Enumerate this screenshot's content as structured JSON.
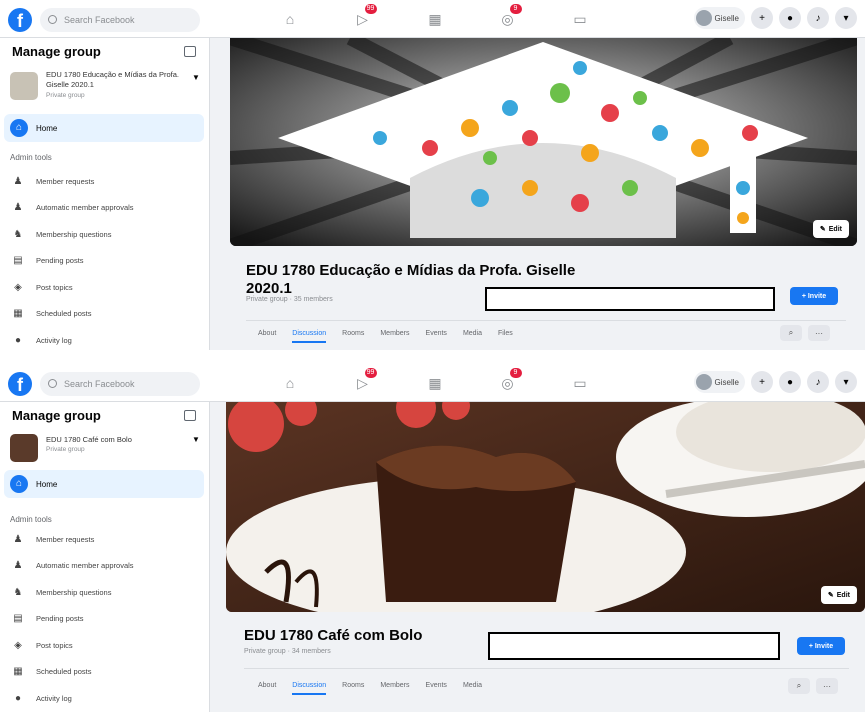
{
  "colors": {
    "brand": "#1877f2",
    "badge": "#e41e3f",
    "highlight_box": "#000000"
  },
  "screens": [
    {
      "search_placeholder": "Search Facebook",
      "nav_badges": [
        "99",
        "9"
      ],
      "profile_name": "Giselle",
      "sidebar": {
        "title": "Manage group",
        "group_name": "EDU 1780 Educação e Mídias da Profa. Giselle 2020.1",
        "group_privacy": "Private group",
        "home_label": "Home",
        "admin_tools_label": "Admin tools",
        "admin_items": [
          "Member requests",
          "Automatic member approvals",
          "Membership questions",
          "Pending posts",
          "Post topics",
          "Scheduled posts",
          "Activity log"
        ]
      },
      "main": {
        "edit_label": "Edit",
        "title": "EDU 1780 Educação e Mídias da Profa. Giselle 2020.1",
        "meta": "Private group · 35 members",
        "invite_label": "+ Invite",
        "tabs": [
          "About",
          "Discussion",
          "Rooms",
          "Members",
          "Events",
          "Media",
          "Files"
        ],
        "active_tab": "Discussion"
      }
    },
    {
      "search_placeholder": "Search Facebook",
      "nav_badges": [
        "99",
        "9"
      ],
      "profile_name": "Giselle",
      "sidebar": {
        "title": "Manage group",
        "group_name": "EDU 1780 Café com Bolo",
        "group_privacy": "Private group",
        "home_label": "Home",
        "admin_tools_label": "Admin tools",
        "admin_items": [
          "Member requests",
          "Automatic member approvals",
          "Membership questions",
          "Pending posts",
          "Post topics",
          "Scheduled posts",
          "Activity log"
        ]
      },
      "main": {
        "edit_label": "Edit",
        "title": "EDU 1780 Café com Bolo",
        "meta": "Private group · 34 members",
        "invite_label": "+ Invite",
        "tabs": [
          "About",
          "Discussion",
          "Rooms",
          "Members",
          "Events",
          "Media"
        ],
        "active_tab": "Discussion"
      }
    }
  ]
}
